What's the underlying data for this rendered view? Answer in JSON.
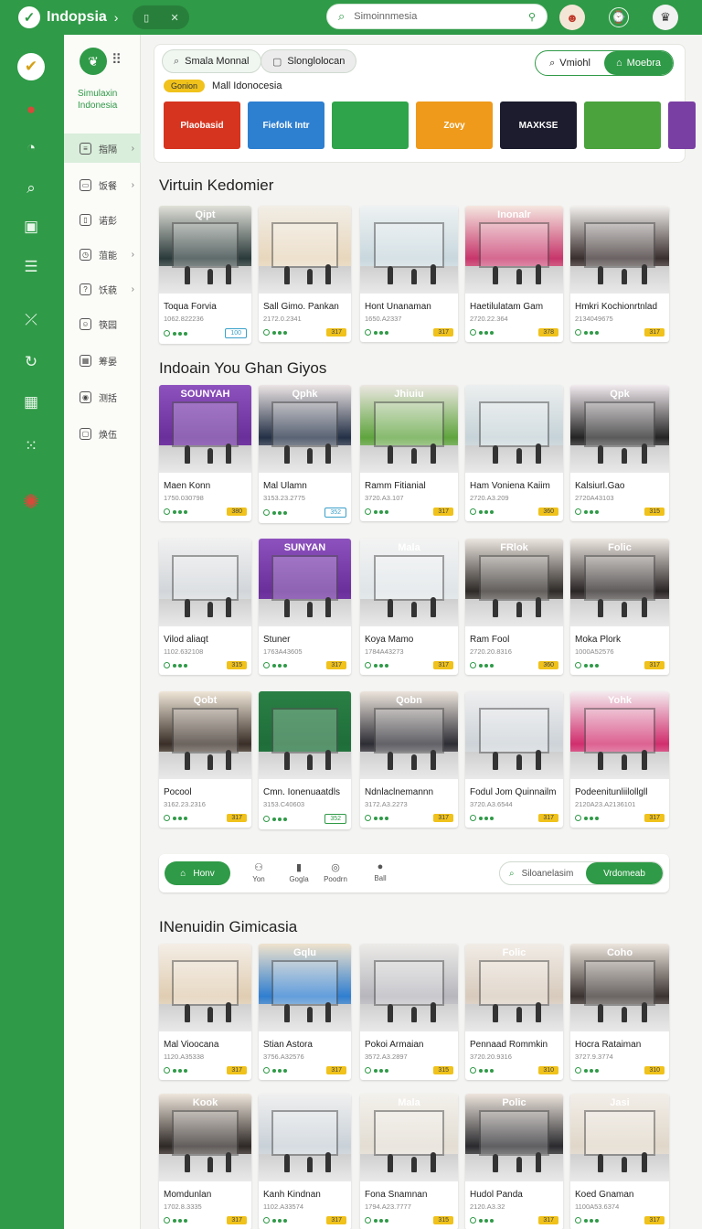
{
  "app": {
    "title": "Indopsia"
  },
  "topbar": {
    "search_value": "Simoinnmesia",
    "pill_icons": [
      "wallet-icon",
      "close-icon"
    ]
  },
  "rail": {
    "icons": [
      "checkmark-logo-icon",
      "apple-mascot-icon",
      "timer-icon",
      "search-icon",
      "bookmark-icon",
      "menu-icon",
      "crossed-icon",
      "refresh-icon",
      "calendar-icon",
      "grid-icon",
      "mascot-icon"
    ]
  },
  "side": {
    "brand_name": "Simulaxin Indonesia",
    "items": [
      {
        "label": "指隔",
        "chevron": true,
        "active": true,
        "icon": "grid-list-icon"
      },
      {
        "label": "饭餐",
        "chevron": true,
        "active": false,
        "icon": "window-icon"
      },
      {
        "label": "诺彭",
        "chevron": false,
        "active": false,
        "icon": "bookmark-icon"
      },
      {
        "label": "菹能",
        "chevron": true,
        "active": false,
        "icon": "clock-icon"
      },
      {
        "label": "饫藐",
        "chevron": true,
        "active": false,
        "icon": "help-icon"
      },
      {
        "label": "筷园",
        "chevron": false,
        "active": false,
        "icon": "user-icon"
      },
      {
        "label": "筹晏",
        "chevron": false,
        "active": false,
        "icon": "calendar-icon"
      },
      {
        "label": "测括",
        "chevron": false,
        "active": false,
        "icon": "camera-icon"
      },
      {
        "label": "焕伍",
        "chevron": false,
        "active": false,
        "icon": "square-icon"
      }
    ]
  },
  "filters": {
    "btn1": "Smala Monnal",
    "btn2": "Slonglolocan",
    "toggle_left": "Vmiohl",
    "toggle_right": "Moebra",
    "tag": "Gonion",
    "tag_text": "Mall Idonocesia",
    "brand_tiles": [
      {
        "label": "Plaobasid",
        "color": "#d6341f"
      },
      {
        "label": "Fiefolk Intr",
        "color": "#2d7fd0"
      },
      {
        "label": "",
        "color": "#2fa44a"
      },
      {
        "label": "Zovy",
        "color": "#ef9a1b"
      },
      {
        "label": "MAXKSE",
        "color": "#1c1c2e"
      },
      {
        "label": "",
        "color": "#4aa33c"
      },
      {
        "label": "",
        "color": "#7a3fa3"
      }
    ]
  },
  "sections": [
    {
      "title": "Virtuin Kedomier",
      "cards": [
        {
          "name": "Toqua Forvia",
          "code": "1062.822236",
          "price": "100",
          "price_style": "alt",
          "sign": "Qipt",
          "img": [
            "#2a3a3a",
            "#e0e0d8"
          ]
        },
        {
          "name": "Sall Gimo. Pankan",
          "code": "2172.0.2341",
          "price": "317",
          "price_style": "",
          "sign": "",
          "img": [
            "#e8d7bd",
            "#f2eee6"
          ]
        },
        {
          "name": "Hont Unanaman",
          "code": "1650.A2337",
          "price": "317",
          "price_style": "",
          "sign": "",
          "img": [
            "#c9d8de",
            "#eef2f3"
          ]
        },
        {
          "name": "Haetilulatam Gam",
          "code": "2720.22.364",
          "price": "378",
          "price_style": "",
          "sign": "Inonalr",
          "img": [
            "#c7366b",
            "#f5e7e0"
          ]
        },
        {
          "name": "Hmkri Kochionrtnlad",
          "code": "2134049675",
          "price": "317",
          "price_style": "",
          "sign": "",
          "img": [
            "#3a2f2f",
            "#f2f0ed"
          ]
        }
      ]
    },
    {
      "title": "Indoain You Ghan Giyos",
      "cards": [
        {
          "name": "Maen Konn",
          "code": "1750.030798",
          "price": "380",
          "price_style": "",
          "sign": "SOUNYAH",
          "img": [
            "#6a2f9a",
            "#8e52bf"
          ]
        },
        {
          "name": "Mal Ulamn",
          "code": "3153.23.2775",
          "price": "352",
          "price_style": "alt",
          "sign": "Qphk",
          "img": [
            "#233046",
            "#ebe4e4"
          ]
        },
        {
          "name": "Ramm Fitianial",
          "code": "3720.A3.107",
          "price": "317",
          "price_style": "",
          "sign": "Jhiuiu",
          "img": [
            "#5fa43e",
            "#ebe7e1"
          ]
        },
        {
          "name": "Ham Voniena Kaiim",
          "code": "2720.A3.209",
          "price": "360",
          "price_style": "",
          "sign": "",
          "img": [
            "#c6d3d8",
            "#ecefef"
          ]
        },
        {
          "name": "Kalsiurl.Gao",
          "code": "2720A43103",
          "price": "315",
          "price_style": "",
          "sign": "Qpk",
          "img": [
            "#242424",
            "#f1eaee"
          ]
        }
      ]
    },
    {
      "title": "",
      "cards": [
        {
          "name": "Vilod aliaqt",
          "code": "1102.632108",
          "price": "315",
          "price_style": "",
          "sign": "",
          "img": [
            "#d2d6da",
            "#f1f1f1"
          ]
        },
        {
          "name": "Stuner",
          "code": "1763A43605",
          "price": "317",
          "price_style": "",
          "sign": "SUNYAN",
          "img": [
            "#6a2f9a",
            "#8e52bf"
          ]
        },
        {
          "name": "Koya Mamo",
          "code": "1784A43273",
          "price": "317",
          "price_style": "",
          "sign": "Mala",
          "img": [
            "#dfe5e8",
            "#f3f3f3"
          ]
        },
        {
          "name": "Ram Fool",
          "code": "2720.20.8316",
          "price": "360",
          "price_style": "",
          "sign": "FRlok",
          "img": [
            "#2e2a27",
            "#ece6e0"
          ]
        },
        {
          "name": "Moka Plork",
          "code": "1000A52576",
          "price": "317",
          "price_style": "",
          "sign": "Folic",
          "img": [
            "#2a2525",
            "#eee8e2"
          ]
        }
      ]
    },
    {
      "title": "",
      "cards": [
        {
          "name": "Pocool",
          "code": "3162.23.2316",
          "price": "317",
          "price_style": "",
          "sign": "Qobt",
          "img": [
            "#3a2f28",
            "#efe6d8"
          ]
        },
        {
          "name": "Cmn. Ionenuaatdls",
          "code": "3153.C40603",
          "price": "352",
          "price_style": "grn",
          "sign": "",
          "img": [
            "#1f6e3a",
            "#2a8045"
          ]
        },
        {
          "name": "Ndnlaclnemannn",
          "code": "3172.A3.2273",
          "price": "317",
          "price_style": "",
          "sign": "Qobn",
          "img": [
            "#2d2d35",
            "#ece4dc"
          ]
        },
        {
          "name": "Fodul Jom Quinnailm",
          "code": "3720.A3.6544",
          "price": "317",
          "price_style": "",
          "sign": "",
          "img": [
            "#cdd3d8",
            "#efeff0"
          ]
        },
        {
          "name": "Podeenitunliilollgll",
          "code": "2120A23.A2136101",
          "price": "317",
          "price_style": "",
          "sign": "Yohk",
          "img": [
            "#d12e6e",
            "#f4ecef"
          ]
        }
      ]
    },
    {
      "title": "INenuidin Gimicasia",
      "cards": [
        {
          "name": "Mal Vioocana",
          "code": "1120.A35338",
          "price": "317",
          "price_style": "",
          "sign": "",
          "img": [
            "#e0cdb2",
            "#f4eee6"
          ]
        },
        {
          "name": "Stian Astora",
          "code": "3756.A32576",
          "price": "317",
          "price_style": "",
          "sign": "Gqlu",
          "img": [
            "#2f7ed0",
            "#f0e3cd"
          ]
        },
        {
          "name": "Pokoi Armaian",
          "code": "3572.A3.2897",
          "price": "315",
          "price_style": "",
          "sign": "",
          "img": [
            "#b7b6bd",
            "#ecebe8"
          ]
        },
        {
          "name": "Pennaad Rommkin",
          "code": "3720.20.9316",
          "price": "310",
          "price_style": "",
          "sign": "Folic",
          "img": [
            "#d8cbbd",
            "#f1ece6"
          ]
        },
        {
          "name": "Hocra Rataiman",
          "code": "3727.9.3774",
          "price": "310",
          "price_style": "",
          "sign": "Coho",
          "img": [
            "#3a3330",
            "#ede6de"
          ]
        }
      ]
    },
    {
      "title": "",
      "cards": [
        {
          "name": "Momdunlan",
          "code": "1702.8.3335",
          "price": "317",
          "price_style": "",
          "sign": "Kook",
          "img": [
            "#2e2826",
            "#efe7dc"
          ]
        },
        {
          "name": "Kanh Kindnan",
          "code": "1102.A33574",
          "price": "317",
          "price_style": "",
          "sign": "",
          "img": [
            "#c9d1d8",
            "#f0f0f0"
          ]
        },
        {
          "name": "Fona Snamnan",
          "code": "1794.A23.7777",
          "price": "315",
          "price_style": "",
          "sign": "Mala",
          "img": [
            "#e3ddd3",
            "#f3f1ec"
          ]
        },
        {
          "name": "Hudol Panda",
          "code": "2120.A3.32",
          "price": "317",
          "price_style": "",
          "sign": "Polic",
          "img": [
            "#2a2a2e",
            "#ede5dd"
          ]
        },
        {
          "name": "Koed Gnaman",
          "code": "1100A53.6374",
          "price": "317",
          "price_style": "",
          "sign": "Jasi",
          "img": [
            "#e0d7c9",
            "#f2eee8"
          ]
        }
      ]
    }
  ],
  "navbar": {
    "home": "Honv",
    "items": [
      {
        "label": "Yon",
        "icon": "people-icon"
      },
      {
        "label": "Gogla",
        "icon": "book-icon"
      },
      {
        "label": "Poodrn",
        "icon": "pin-icon"
      },
      {
        "label": "Ball",
        "icon": "ball-icon"
      }
    ],
    "search": "Siloanelasim",
    "search_btn": "Vrdomeab"
  }
}
